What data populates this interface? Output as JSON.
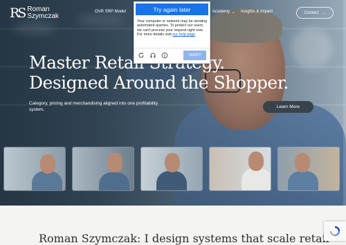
{
  "logo": {
    "mark": "RS",
    "line1": "Roman",
    "line2": "Szymczak"
  },
  "nav": {
    "items": [
      {
        "label": "OVR SRP Model"
      },
      {
        "label": "Academy"
      },
      {
        "label": "Insights & Impact"
      }
    ],
    "contact_label": "Contact"
  },
  "hero": {
    "headline": "Master Retail Strategy. Designed Around the Shopper.",
    "subhead": "Category, pricing and merchandising aligned into one profitability system.",
    "cta_label": "Learn More"
  },
  "bottom": {
    "title": "Roman Szymczak: I design systems that scale retail"
  },
  "captcha": {
    "header": "Try again later",
    "message": "Your computer or network may be sending automated queries. To protect our users, we can't process your request right now. For more details visit",
    "link_text": "our help page",
    "verify_label": "VERIFY",
    "icons": [
      "reload-icon",
      "audio-icon",
      "info-icon"
    ]
  },
  "colors": {
    "hero_overlay": "#3d5263",
    "captcha_header": "#1a73e8",
    "verify_button": "#8fb6ec",
    "cta_button": "#38424a"
  }
}
